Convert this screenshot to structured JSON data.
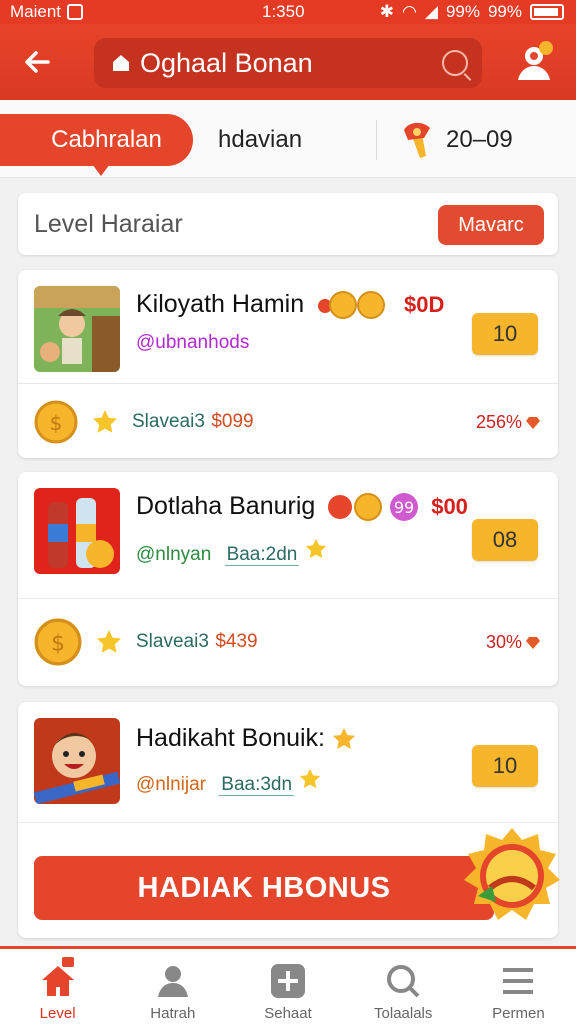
{
  "status": {
    "carrier": "Maient",
    "time": "1:350",
    "signal_text": "99%",
    "battery_text": "99%"
  },
  "header": {
    "title": "Oghaal Bonan"
  },
  "tabs": {
    "active": "Cabhralan",
    "second": "hdavian",
    "score": "20–09"
  },
  "level": {
    "label": "Level Haraiar",
    "button": "Mavarc"
  },
  "cards": [
    {
      "name": "Kiloyath Hamin",
      "price": "$0D",
      "sub": "@ubnanhods",
      "badge": "10",
      "footer_label": "Slaveai3",
      "footer_amount": "$099",
      "pct": "256%"
    },
    {
      "name": "Dotlaha Banurig",
      "price": "$00",
      "sub": "@nlnyan",
      "sub_box": "Baa:2dn",
      "badge": "08",
      "footer_label": "Slaveai3",
      "footer_amount": "$439",
      "pct": "30%"
    },
    {
      "name": "Hadikaht Bonuik:",
      "sub": "@nlnijar",
      "sub_box": "Baa:3dn",
      "badge": "10"
    }
  ],
  "cta": {
    "label": "HADIAK HBONUS"
  },
  "bottom_nav": [
    {
      "label": "Level",
      "icon": "home-icon"
    },
    {
      "label": "Hatrah",
      "icon": "user-icon"
    },
    {
      "label": "Sehaat",
      "icon": "plus-icon"
    },
    {
      "label": "Tolaalals",
      "icon": "search-icon"
    },
    {
      "label": "Permen",
      "icon": "menu-icon"
    }
  ],
  "colors": {
    "primary": "#e5452b",
    "badge": "#f6b52a",
    "price": "#d8201a"
  }
}
